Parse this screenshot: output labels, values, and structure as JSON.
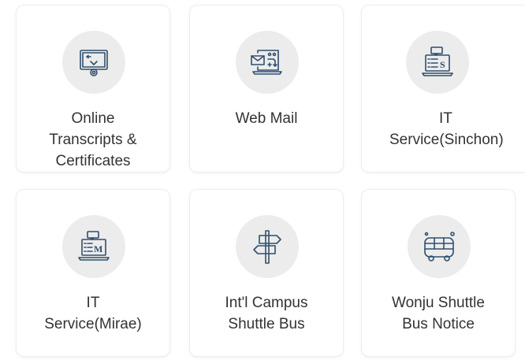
{
  "tiles": [
    {
      "label": "Online\nTranscripts &\nCertificates",
      "icon": "certificate-icon"
    },
    {
      "label": "Web Mail",
      "icon": "web-mail-icon"
    },
    {
      "label_line1": "IT",
      "label_line2": "Service(Sinchon)",
      "icon": "it-service-sinchon-icon"
    },
    {
      "label": "IT\nService(Mirae)",
      "icon": "it-service-mirae-icon"
    },
    {
      "label": "Int'l Campus\nShuttle Bus",
      "icon": "signpost-icon"
    },
    {
      "label": "Wonju Shuttle\nBus Notice",
      "icon": "bus-icon"
    }
  ],
  "colors": {
    "icon_stroke": "#2f4f6f",
    "icon_circle": "#ececec",
    "text": "#333333",
    "card_border": "#ebeef2"
  }
}
